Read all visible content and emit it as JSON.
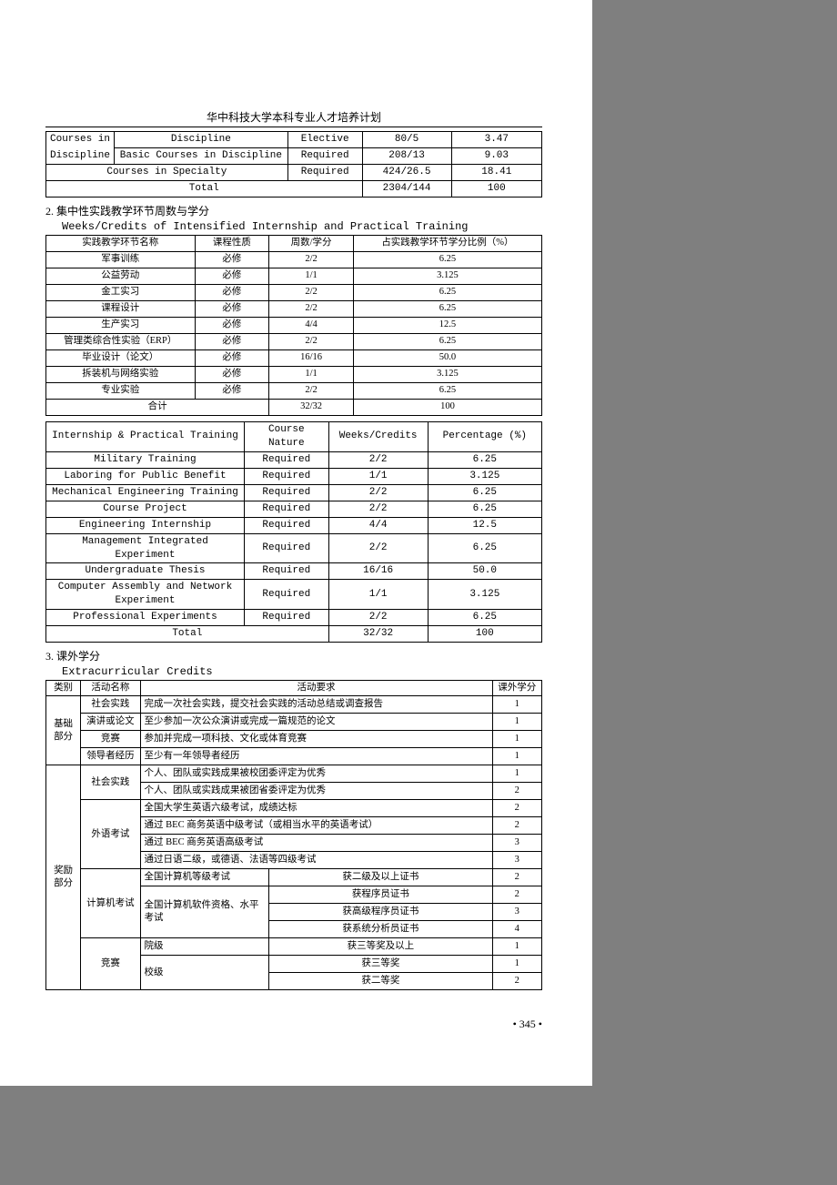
{
  "header": "华中科技大学本科专业人才培养计划",
  "table1": {
    "r1c1": "Courses in",
    "r1c2": "Discipline",
    "r1c3": "Elective",
    "r1c4": "80/5",
    "r1c5": "3.47",
    "r2c1": "Discipline",
    "r2c2": "Basic Courses in Discipline",
    "r2c3": "Required",
    "r2c4": "208/13",
    "r2c5": "9.03",
    "r3c12": "Courses in Specialty",
    "r3c3": "Required",
    "r3c4": "424/26.5",
    "r3c5": "18.41",
    "r4c123": "Total",
    "r4c4": "2304/144",
    "r4c5": "100"
  },
  "sec2": {
    "cn": "2. 集中性实践教学环节周数与学分",
    "en": "Weeks/Credits of Intensified Internship and Practical Training"
  },
  "table2cn": {
    "h1": "实践教学环节名称",
    "h2": "课程性质",
    "h3": "周数/学分",
    "h4": "占实践教学环节学分比例（%）",
    "rows": [
      [
        "军事训练",
        "必修",
        "2/2",
        "6.25"
      ],
      [
        "公益劳动",
        "必修",
        "1/1",
        "3.125"
      ],
      [
        "金工实习",
        "必修",
        "2/2",
        "6.25"
      ],
      [
        "课程设计",
        "必修",
        "2/2",
        "6.25"
      ],
      [
        "生产实习",
        "必修",
        "4/4",
        "12.5"
      ],
      [
        "管理类综合性实验（ERP）",
        "必修",
        "2/2",
        "6.25"
      ],
      [
        "毕业设计（论文）",
        "必修",
        "16/16",
        "50.0"
      ],
      [
        "拆装机与网络实验",
        "必修",
        "1/1",
        "3.125"
      ],
      [
        "专业实验",
        "必修",
        "2/2",
        "6.25"
      ]
    ],
    "total_lbl": "合计",
    "total_wk": "32/32",
    "total_pct": "100"
  },
  "table2en": {
    "h1": "Internship & Practical Training",
    "h2": "Course Nature",
    "h3": "Weeks/Credits",
    "h4": "Percentage (%)",
    "rows": [
      [
        "Military Training",
        "Required",
        "2/2",
        "6.25"
      ],
      [
        "Laboring for Public Benefit",
        "Required",
        "1/1",
        "3.125"
      ],
      [
        "Mechanical Engineering Training",
        "Required",
        "2/2",
        "6.25"
      ],
      [
        "Course Project",
        "Required",
        "2/2",
        "6.25"
      ],
      [
        "Engineering Internship",
        "Required",
        "4/4",
        "12.5"
      ],
      [
        "Management Integrated Experiment",
        "Required",
        "2/2",
        "6.25"
      ],
      [
        "Undergraduate Thesis",
        "Required",
        "16/16",
        "50.0"
      ],
      [
        "Computer Assembly and Network Experiment",
        "Required",
        "1/1",
        "3.125"
      ],
      [
        "Professional Experiments",
        "Required",
        "2/2",
        "6.25"
      ]
    ],
    "total_lbl": "Total",
    "total_wk": "32/32",
    "total_pct": "100"
  },
  "sec3": {
    "cn": "3. 课外学分",
    "en": "Extracurricular Credits"
  },
  "table3": {
    "h1": "类别",
    "h2": "活动名称",
    "h3": "活动要求",
    "h4": "课外学分",
    "cat1": "基础部分",
    "cat1rows": [
      [
        "社会实践",
        "完成一次社会实践，提交社会实践的活动总结或调查报告",
        "1"
      ],
      [
        "演讲或论文",
        "至少参加一次公众演讲或完成一篇规范的论文",
        "1"
      ],
      [
        "竞赛",
        "参加并完成一项科技、文化或体育竞赛",
        "1"
      ],
      [
        "领导者经历",
        "至少有一年领导者经历",
        "1"
      ]
    ],
    "cat2": "奖励部分",
    "social": "社会实践",
    "social_rows": [
      [
        "个人、团队或实践成果被校团委评定为优秀",
        "1"
      ],
      [
        "个人、团队或实践成果被团省委评定为优秀",
        "2"
      ]
    ],
    "lang": "外语考试",
    "lang_rows": [
      [
        "全国大学生英语六级考试，成绩达标",
        "2"
      ],
      [
        "通过 BEC 商务英语中级考试（或相当水平的英语考试）",
        "2"
      ],
      [
        "通过 BEC 商务英语高级考试",
        "3"
      ],
      [
        "通过日语二级，或德语、法语等四级考试",
        "3"
      ]
    ],
    "comp": "计算机考试",
    "comp_a": "全国计算机等级考试",
    "comp_a_req": "获二级及以上证书",
    "comp_a_cr": "2",
    "comp_b": "全国计算机软件资格、水平考试",
    "comp_b_rows": [
      [
        "获程序员证书",
        "2"
      ],
      [
        "获高级程序员证书",
        "3"
      ],
      [
        "获系统分析员证书",
        "4"
      ]
    ],
    "contest": "竞赛",
    "contest_a": "院级",
    "contest_a_req": "获三等奖及以上",
    "contest_a_cr": "1",
    "contest_b": "校级",
    "contest_b_rows": [
      [
        "获三等奖",
        "1"
      ],
      [
        "获二等奖",
        "2"
      ]
    ]
  },
  "pagenum": "• 345 •"
}
